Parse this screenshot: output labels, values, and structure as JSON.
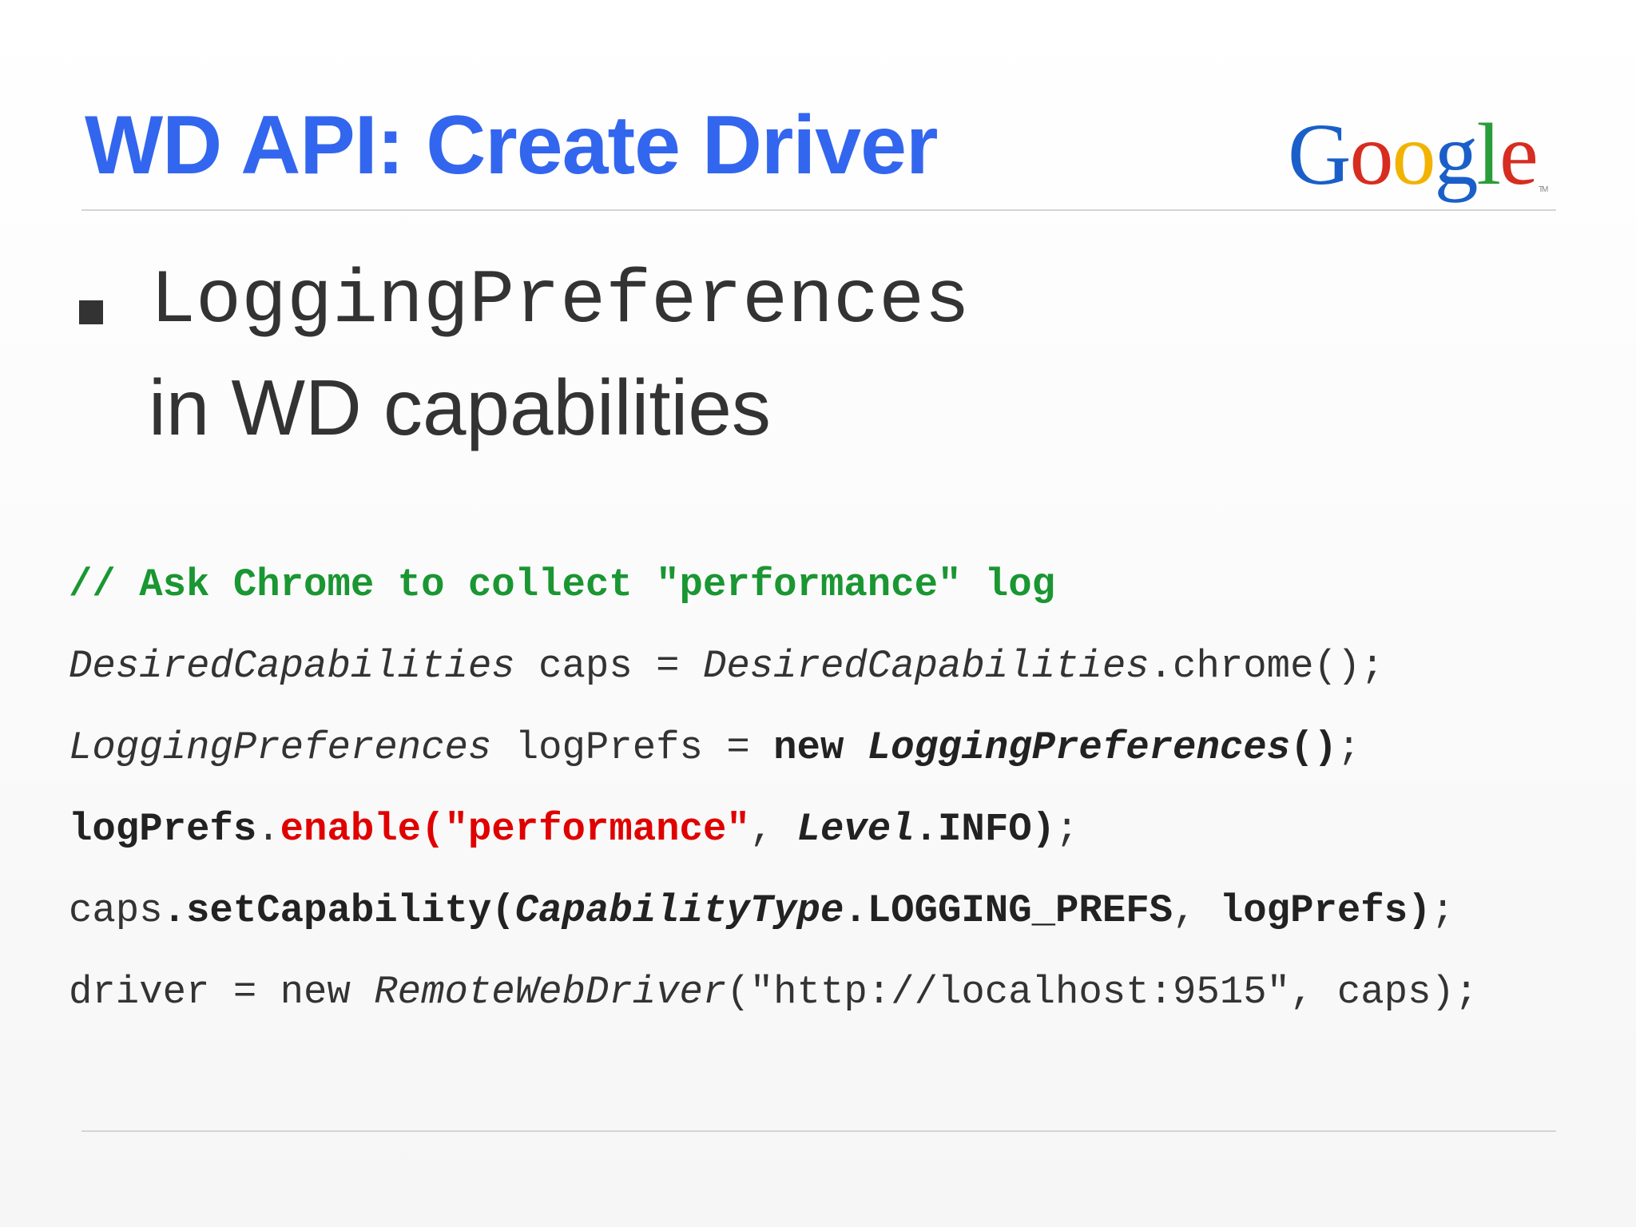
{
  "slide": {
    "title": "WD API: Create Driver",
    "logo": {
      "letters": [
        "G",
        "o",
        "o",
        "g",
        "l",
        "e"
      ],
      "colors": [
        "#1a5fc9",
        "#d62d20",
        "#f2b300",
        "#1a5fc9",
        "#2a9d3b",
        "#d62d20"
      ],
      "trademark": "TM"
    },
    "bullet": {
      "line1": "LoggingPreferences",
      "line2": "in WD capabilities"
    },
    "code": {
      "line1": {
        "comment": "// Ask Chrome to collect \"performance\" log"
      },
      "line2": {
        "type1": "DesiredCapabilities",
        "mid": " caps = ",
        "type2": "DesiredCapabilities",
        "tail": ".chrome();"
      },
      "line3": {
        "type1": "LoggingPreferences",
        "mid": " logPrefs = ",
        "kw": "new",
        "sp": " ",
        "type2": "LoggingPreferences",
        "parens": "()",
        "semi": ";"
      },
      "line4": {
        "obj": "logPrefs",
        "dot": ".",
        "call": "enable(\"performance\"",
        "comma": ", ",
        "cls": "Level",
        "tail": ".INFO)",
        "semi": ";"
      },
      "line5": {
        "obj": "caps",
        "call": ".setCapability(",
        "cls": "CapabilityType",
        "tail": ".LOGGING_PREFS",
        "comma": ", ",
        "arg": "logPrefs)",
        "semi": ";"
      },
      "line6": {
        "head": "driver = new ",
        "cls": "RemoteWebDriver",
        "tail": "(\"http://localhost:9515\", caps);"
      }
    }
  }
}
